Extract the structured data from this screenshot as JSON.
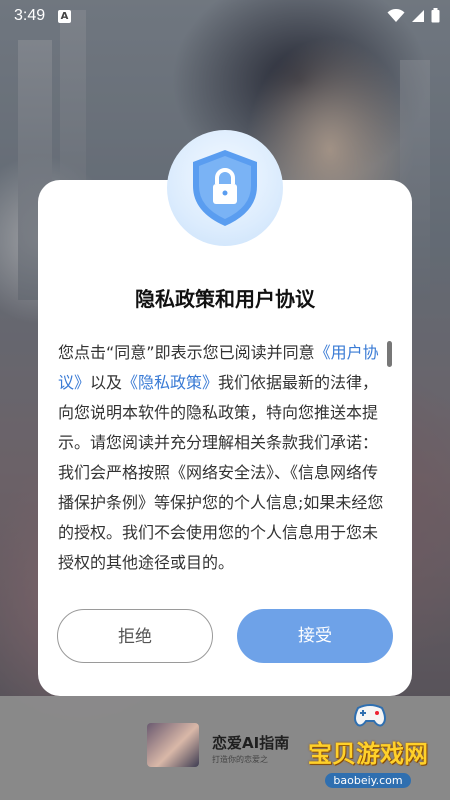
{
  "status_bar": {
    "time": "3:49"
  },
  "dialog": {
    "title": "隐私政策和用户协议",
    "body_part1": "您点击“同意”即表示您已阅读并同意",
    "link_user_agreement": "《用户协议》",
    "body_part2": "以及",
    "link_privacy_policy": "《隐私政策》",
    "body_part3": "我们依据最新的法律，向您说明本软件的隐私政策，特向您推送本提示。请您阅读并充分理解相关条款我们承诺：我们会严格按照《网络安全法》、《信息网络传播保护条例》等保护您的个人信息;如果未经您的授权。我们不会使用您的个人信息用于您未授权的其他途径或目的。",
    "reject_label": "拒绝",
    "accept_label": "接受"
  },
  "background_app": {
    "name": "恋爱AI指南",
    "subtitle": "打造你的恋爱之"
  },
  "watermark": {
    "text": "宝贝游戏网",
    "url": "baobeiy.com"
  },
  "colors": {
    "accent": "#6ea2e8",
    "link": "#3a7bd5"
  }
}
